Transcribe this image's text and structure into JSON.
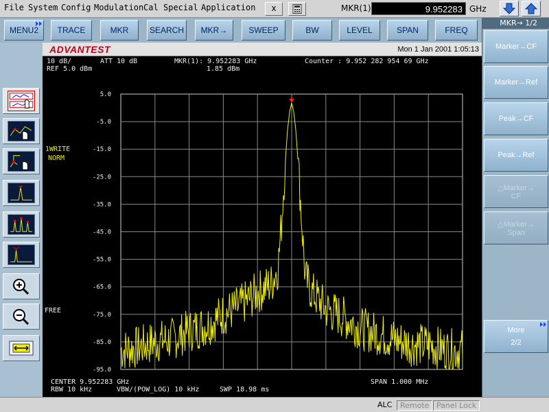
{
  "menubar": {
    "items": [
      "File",
      "System",
      "Config",
      "Modulation",
      "Cal",
      "Special",
      "Application"
    ],
    "close_label": "x",
    "calc_icon": "calculator-icon",
    "marker_label": "MKR(1):",
    "marker_value": "9.952283",
    "marker_unit": "GHz",
    "down_icon": "arrow-down-icon",
    "up_icon": "arrow-up-icon"
  },
  "softkeys": [
    "MENU2",
    "TRACE",
    "MKR",
    "SEARCH",
    "MKR→",
    "SWEEP",
    "BW",
    "LEVEL",
    "SPAN",
    "FREQ"
  ],
  "screen": {
    "brand": "ADVANTEST",
    "datetime": "Mon 1 Jan 2001 1:05:13",
    "scale": "10 dB/",
    "ref": "REF 5.0 dBm",
    "att": "ATT 10 dB",
    "marker_line": "MKR(1): 9.952283 GHz",
    "marker_level": "1.85 dBm",
    "counter": "Counter : 9.952 282 954 69 GHz",
    "trace_mode_1": "1WRITE",
    "trace_mode_2": "NORM",
    "free_label": "FREE",
    "center": "CENTER 9.952283 GHz",
    "span": "SPAN 1.000 MHz",
    "rbw": "RBW 10 kHz",
    "vbw": "VBW/(POW_LOG) 10 kHz",
    "swp": "SWP 18.98 ms"
  },
  "chart_data": {
    "type": "line",
    "title": "",
    "xlabel": "",
    "ylabel": "",
    "y_tick_labels": [
      "5.0",
      "-5.0",
      "-15.0",
      "-25.0",
      "-35.0",
      "-45.0",
      "-55.0",
      "-65.0",
      "-75.0",
      "-85.0",
      "-95.0"
    ],
    "ylim": [
      -95,
      5
    ],
    "xlim_mhz": [
      -0.5,
      0.5
    ],
    "grid": true,
    "trace_color": "#f0f000",
    "series": [
      {
        "x": [
          -0.5,
          -0.45,
          -0.4,
          -0.35,
          -0.3,
          -0.25,
          -0.2,
          -0.15,
          -0.1,
          -0.06,
          -0.04,
          -0.03,
          -0.02,
          -0.012,
          -0.006,
          0.0,
          0.006,
          0.012,
          0.02,
          0.03,
          0.04,
          0.06,
          0.1,
          0.15,
          0.2,
          0.25,
          0.3,
          0.35,
          0.4,
          0.45,
          0.5
        ],
        "y": [
          -88,
          -87,
          -85,
          -84,
          -81,
          -79,
          -75,
          -72,
          -67,
          -64,
          -58,
          -42,
          -22,
          -8,
          -1.5,
          1.85,
          -1.5,
          -8,
          -22,
          -42,
          -62,
          -67,
          -73,
          -76,
          -80,
          -82,
          -84,
          -86,
          -86,
          -88,
          -88
        ]
      }
    ],
    "marker": {
      "x": 0.0,
      "y": 1.85,
      "label": "1"
    }
  },
  "rightpanel": {
    "title": "MKR→ 1/2",
    "keys": [
      {
        "label": "Marker→CF",
        "enabled": true
      },
      {
        "label": "Marker→Ref",
        "enabled": true
      },
      {
        "label": "Peak→CF",
        "enabled": true
      },
      {
        "label": "Peak→Ref",
        "enabled": true
      },
      {
        "label": "△Marker→ CF",
        "enabled": false
      },
      {
        "label": "△Marker→ Span",
        "enabled": false
      }
    ],
    "more_label": "More",
    "more_page": "2/2"
  },
  "statusbar": {
    "alc": "ALC",
    "remote": "Remote",
    "panel_lock": "Panel Lock"
  },
  "colors": {
    "softkey_blue": "#9cb6c8",
    "trace": "#f0f000",
    "brand_red": "#c0001c"
  }
}
